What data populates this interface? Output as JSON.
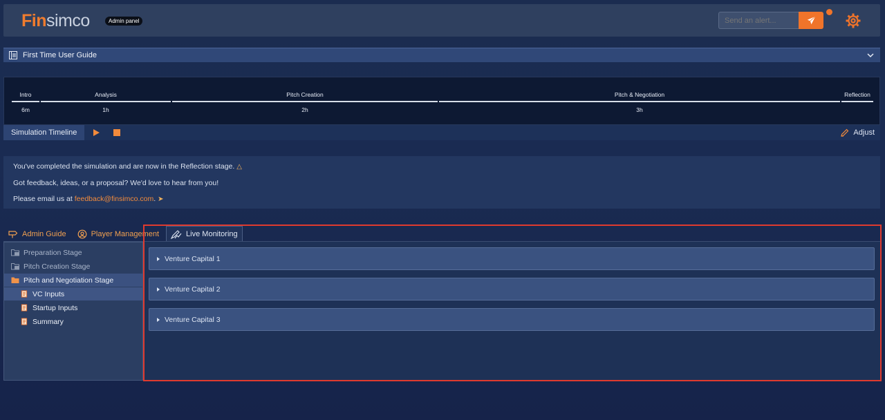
{
  "header": {
    "logo_fin": "Fin",
    "logo_sim": "simco",
    "badge": "Admin panel",
    "alert_placeholder": "Send an alert...",
    "accent_color": "#f0742a"
  },
  "guide": {
    "label": "First Time User Guide"
  },
  "timeline": {
    "stages": [
      {
        "name": "Intro",
        "duration": "6m"
      },
      {
        "name": "Analysis",
        "duration": "1h"
      },
      {
        "name": "Pitch Creation",
        "duration": "2h"
      },
      {
        "name": "Pitch & Negotiation",
        "duration": "3h"
      },
      {
        "name": "Reflection",
        "duration": ""
      }
    ],
    "title": "Simulation Timeline",
    "adjust": "Adjust"
  },
  "info": {
    "line1": "You've completed the simulation and are now in the Reflection stage.",
    "line2": "Got feedback, ideas, or a proposal? We'd love to hear from you!",
    "line3_prefix": "Please email us at ",
    "email": "feedback@finsimco.com",
    "line3_suffix": "."
  },
  "tabs": [
    {
      "label": "Admin Guide",
      "icon": "signpost-icon"
    },
    {
      "label": "Player Management",
      "icon": "user-gear-icon"
    },
    {
      "label": "Live Monitoring",
      "icon": "chart-pen-icon"
    }
  ],
  "tree": {
    "items": [
      {
        "label": "Preparation Stage",
        "icon": "folder-icon"
      },
      {
        "label": "Pitch Creation Stage",
        "icon": "folder-icon"
      },
      {
        "label": "Pitch and Negotiation Stage",
        "icon": "folder-open-icon"
      },
      {
        "label": "VC Inputs",
        "icon": "scroll-icon"
      },
      {
        "label": "Startup Inputs",
        "icon": "scroll-icon"
      },
      {
        "label": "Summary",
        "icon": "scroll-icon"
      }
    ]
  },
  "monitor": {
    "sections": [
      {
        "label": "Venture Capital 1"
      },
      {
        "label": "Venture Capital 2"
      },
      {
        "label": "Venture Capital 3"
      }
    ]
  }
}
